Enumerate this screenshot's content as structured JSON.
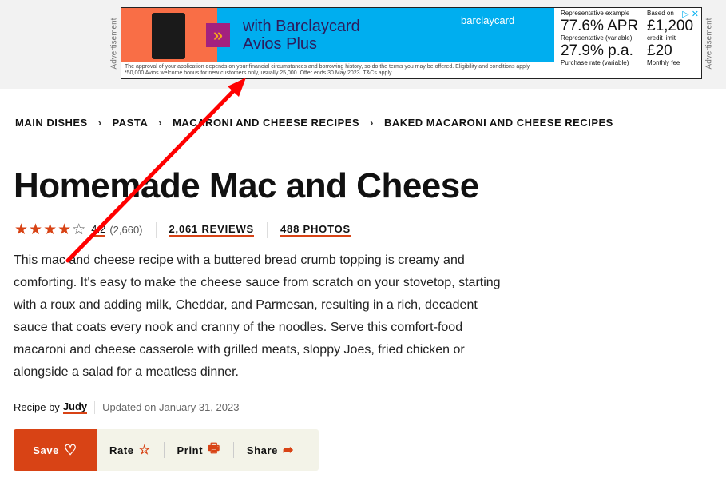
{
  "ad": {
    "label": "Advertisement",
    "headline_1": "with Barclaycard",
    "headline_2": "Avios Plus",
    "brand": "barclaycard",
    "rep_example": "Representative example",
    "apr": "77.6% APR",
    "apr_note": "Representative (variable)",
    "purchase": "27.9% p.a.",
    "purchase_note": "Purchase rate (variable)",
    "based_on": "Based on",
    "limit": "£1,200",
    "limit_note": "credit limit",
    "fee": "£20",
    "fee_note": "Monthly fee",
    "disclaimer_1": "The approval of your application depends on your financial circumstances and borrowing history, so do the terms you may be offered. Eligibility and conditions apply.",
    "disclaimer_2": "*50,000 Avios welcome bonus for new customers only, usually 25,000. Offer ends 30 May 2023. T&Cs apply."
  },
  "breadcrumb": [
    "MAIN DISHES",
    "PASTA",
    "MACARONI AND CHEESE RECIPES",
    "BAKED MACARONI AND CHEESE RECIPES"
  ],
  "title": "Homemade Mac and Cheese",
  "rating": {
    "value": "4.2",
    "count": "(2,660)",
    "stars": 4.2,
    "reviews": "2,061 REVIEWS",
    "photos": "488 PHOTOS"
  },
  "description": "This mac and cheese recipe with a buttered bread crumb topping is creamy and comforting. It's easy to make the cheese sauce from scratch on your stovetop, starting with a roux and adding milk, Cheddar, and Parmesan, resulting in a rich, decadent sauce that coats every nook and cranny of the noodles. Serve this comfort-food macaroni and cheese casserole with grilled meats, sloppy Joes, fried chicken or alongside a salad for a meatless dinner.",
  "byline": {
    "prefix": "Recipe by",
    "author": "Judy",
    "updated": "Updated on January 31, 2023"
  },
  "actions": {
    "save": "Save",
    "rate": "Rate",
    "print": "Print",
    "share": "Share"
  },
  "colors": {
    "accent": "#d84315",
    "annotation_arrow": "#ff0000"
  }
}
